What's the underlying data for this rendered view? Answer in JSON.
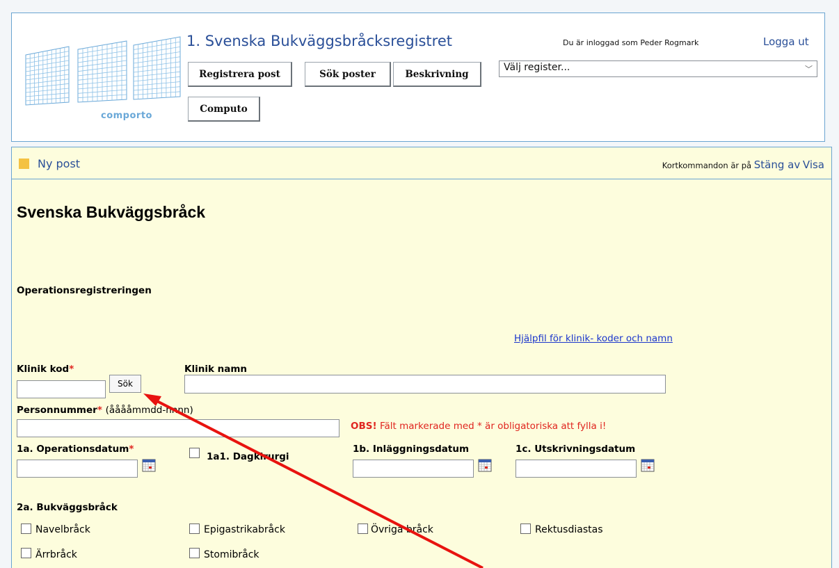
{
  "header": {
    "logo_text": "comporto",
    "app_title": "1. Svenska Bukväggsbråcksregistret",
    "logged_in": "Du är inloggad som Peder Rogmark",
    "logout": "Logga ut",
    "buttons": {
      "registrera": "Registrera post",
      "sok": "Sök poster",
      "beskrivning": "Beskrivning",
      "computo": "Computo"
    },
    "register_select": "Välj register..."
  },
  "panel": {
    "bar_title": "Ny post",
    "shortcut_text": "Kortkommandon är på",
    "shortcut_off": "Stäng av",
    "shortcut_show": "Visa"
  },
  "form": {
    "title": "Svenska Bukväggsbråck",
    "section": "Operationsregistreringen",
    "help_link": "Hjälpfil för klinik- koder och namn",
    "klinik_kod_label": "Klinik kod",
    "klinik_namn_label": "Klinik namn",
    "sok_button": "Sök",
    "personnummer_label": "Personnummer",
    "personnummer_hint": "(ååååmmdd-nnnn)",
    "obs_bold": "OBS!",
    "obs_text": "Fält markerade med * är obligatoriska att fylla i!",
    "required_marker": "*",
    "op_datum_label": "1a. Operationsdatum",
    "dagkirurgi_label": "1a1. Dagkirurgi",
    "inlaggning_label": "1b. Inläggningsdatum",
    "utskrivning_label": "1c. Utskrivningsdatum",
    "hernia_section": "2a. Bukväggsbråck",
    "hernia_types": {
      "navel": "Navelbråck",
      "epigastrika": "Epigastrikabråck",
      "ovriga": "Övriga bråck",
      "rektus": "Rektusdiastas",
      "arr": "Ärrbråck",
      "stomi": "Stomibråck"
    }
  },
  "colors": {
    "accent_blue": "#2a4f98",
    "panel_bg": "#fdfddd",
    "required_red": "#e0251f",
    "annotation_arrow": "#e8130f"
  }
}
